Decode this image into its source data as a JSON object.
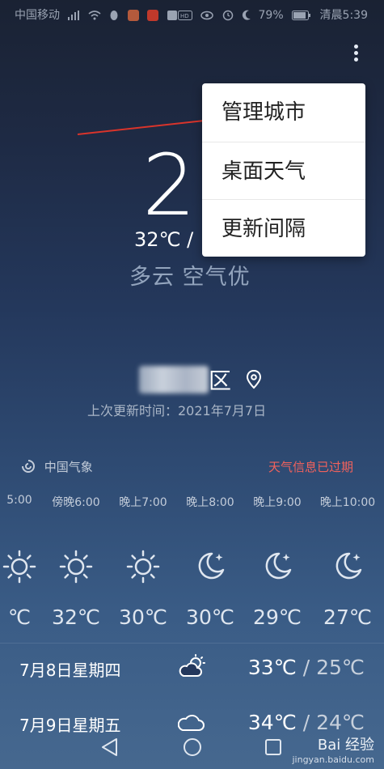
{
  "status_bar": {
    "carrier": "中国移动",
    "battery": "79%",
    "time": "清晨5:39"
  },
  "menu": {
    "items": [
      "管理城市",
      "桌面天气",
      "更新间隔"
    ]
  },
  "current": {
    "temperature": "2",
    "range": "32℃ /",
    "condition": "多云  空气优"
  },
  "location": {
    "district": "区",
    "last_updated": "上次更新时间：2021年7月7日"
  },
  "source": {
    "name": "中国气象",
    "expired_notice": "天气信息已过期"
  },
  "hourly": [
    {
      "time": "5:00",
      "icon": "sun-icon",
      "temp": "℃"
    },
    {
      "time": "傍晚6:00",
      "icon": "sun-icon",
      "temp": "32℃"
    },
    {
      "time": "晚上7:00",
      "icon": "sun-icon",
      "temp": "30℃"
    },
    {
      "time": "晚上8:00",
      "icon": "moon-star-icon",
      "temp": "30℃"
    },
    {
      "time": "晚上9:00",
      "icon": "moon-star-icon",
      "temp": "29℃"
    },
    {
      "time": "晚上10:00",
      "icon": "moon-star-icon",
      "temp": "27℃"
    }
  ],
  "daily": [
    {
      "date": "7月8日星期四",
      "icon": "partly-cloudy-icon",
      "high": "33℃",
      "sep": " / ",
      "low": "25℃"
    },
    {
      "date": "7月9日星期五",
      "icon": "cloud-icon",
      "high": "34℃",
      "sep": " / ",
      "low": "24℃"
    }
  ],
  "watermark": {
    "brand": "Bai 经验",
    "url": "jingyan.baidu.com"
  },
  "colors": {
    "expired": "#f2625c",
    "menu_bg": "#ffffff"
  }
}
